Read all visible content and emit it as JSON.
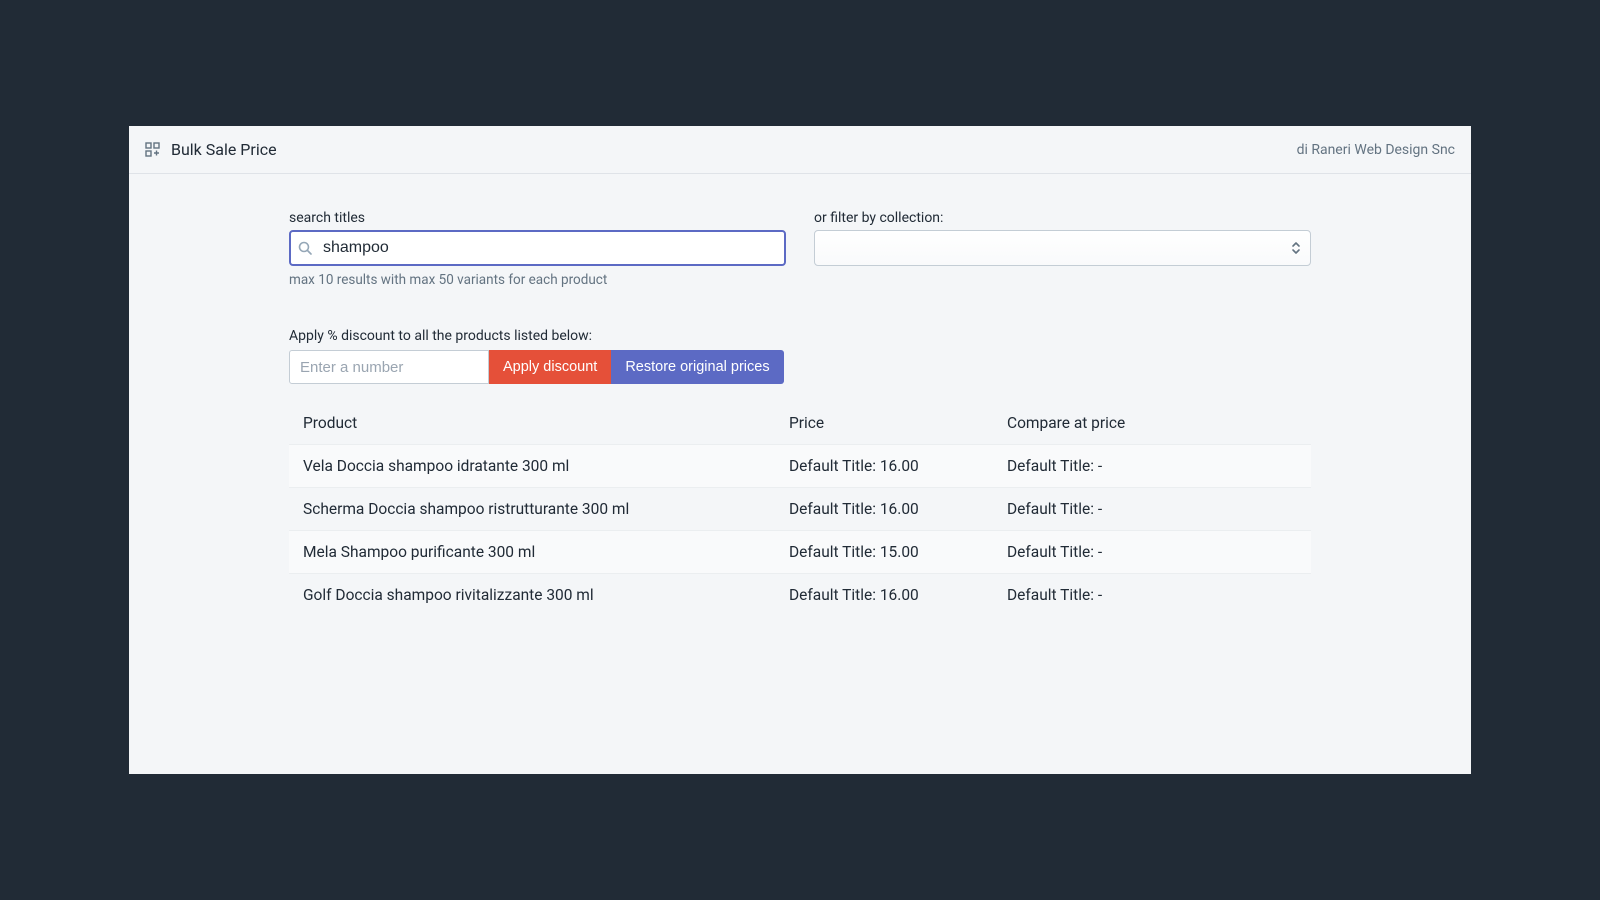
{
  "header": {
    "title": "Bulk Sale Price",
    "credit": "di Raneri Web Design Snc"
  },
  "filters": {
    "search_label": "search titles",
    "search_value": "shampoo",
    "search_hint": "max 10 results with max 50 variants for each product",
    "collection_label": "or filter by collection:",
    "collection_value": ""
  },
  "discount": {
    "label": "Apply % discount to all the products listed below:",
    "input_placeholder": "Enter a number",
    "apply_label": "Apply discount",
    "restore_label": "Restore original prices"
  },
  "table": {
    "headers": {
      "product": "Product",
      "price": "Price",
      "compare": "Compare at price"
    },
    "rows": [
      {
        "product": "Vela Doccia shampoo idratante 300 ml",
        "price": "Default Title: 16.00",
        "compare": "Default Title: -"
      },
      {
        "product": "Scherma Doccia shampoo ristrutturante 300 ml",
        "price": "Default Title: 16.00",
        "compare": "Default Title: -"
      },
      {
        "product": "Mela Shampoo purificante 300 ml",
        "price": "Default Title: 15.00",
        "compare": "Default Title: -"
      },
      {
        "product": "Golf Doccia shampoo rivitalizzante 300 ml",
        "price": "Default Title: 16.00",
        "compare": "Default Title: -"
      }
    ]
  }
}
